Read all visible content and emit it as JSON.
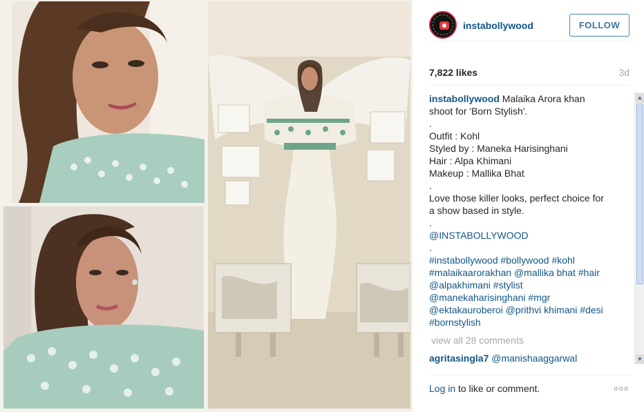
{
  "post": {
    "username": "instabollywood",
    "follow_label": "FOLLOW",
    "likes": "7,822 likes",
    "time_ago": "3d",
    "caption_author": "instabollywood",
    "caption_lines": [
      "Malaika Arora khan",
      "shoot for 'Born Stylish'.",
      ".",
      "Outfit : Kohl",
      "Styled by : Maneka Harisinghani",
      "Hair : Alpa Khimani",
      "Makeup : Mallika Bhat",
      ".",
      "Love those killer looks, perfect choice for",
      "a show based in style.",
      "."
    ],
    "mention": "@INSTABOLLYWOOD",
    "dot": ".",
    "hashtag_lines": [
      "#instabollywood #bollywood #kohl",
      "#malaikaarorakhan @mallika  bhat #hair",
      "@alpakhimani #stylist",
      "@manekaharisinghani #mgr",
      "@ektakauroberoi @prithvi  khimani #desi",
      "#bornstylish"
    ],
    "view_all": "view all 28 comments",
    "comment": {
      "author": "agritasingla7",
      "text": "@manishaaggarwal"
    },
    "footer": {
      "login_link": "Log in",
      "login_rest": " to like or comment.",
      "more": "ooo"
    }
  },
  "icons": {
    "avatar": "instagram-camera-logo",
    "scroll_up": "triangle-up-icon",
    "scroll_down": "triangle-down-icon",
    "more": "ellipsis-icon"
  },
  "colors": {
    "link": "#125688",
    "follow_border": "#4a86b2",
    "muted": "#a5a7aa"
  }
}
